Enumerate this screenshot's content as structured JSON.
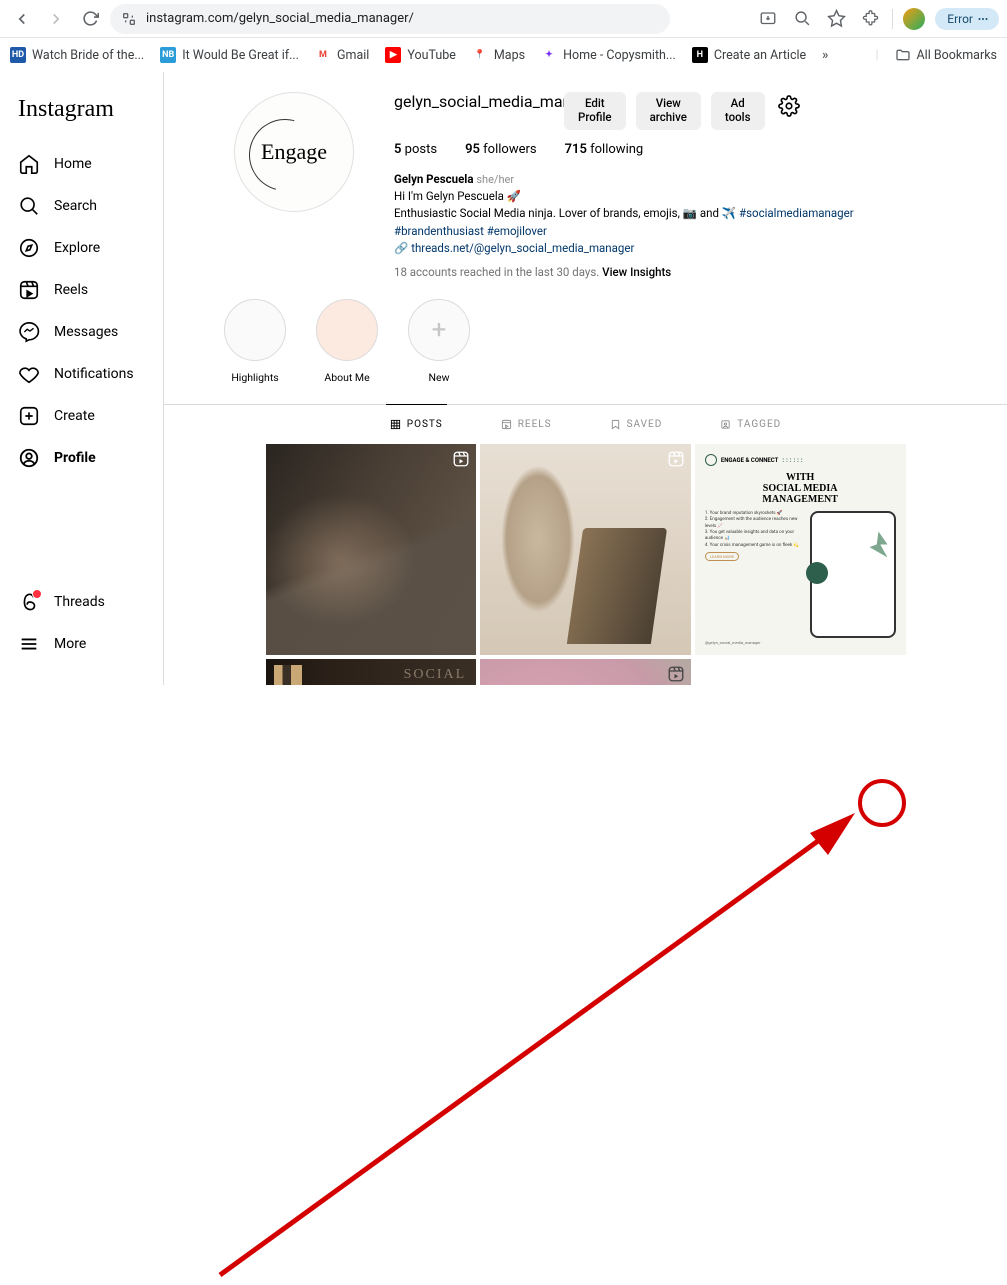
{
  "browser": {
    "url": "instagram.com/gelyn_social_media_manager/",
    "error_label": "Error"
  },
  "bookmarks": [
    {
      "icon": "HD",
      "icon_bg": "#1e5aa8",
      "icon_color": "#fff",
      "label": "Watch Bride of the..."
    },
    {
      "icon": "NB",
      "icon_bg": "#2b9cd8",
      "icon_color": "#fff",
      "label": "It Would Be Great if..."
    },
    {
      "icon": "M",
      "icon_bg": "#fff",
      "icon_color": "#ea4335",
      "label": "Gmail"
    },
    {
      "icon": "▶",
      "icon_bg": "#ff0000",
      "icon_color": "#fff",
      "label": "YouTube"
    },
    {
      "icon": "📍",
      "icon_bg": "transparent",
      "icon_color": "#34a853",
      "label": "Maps"
    },
    {
      "icon": "✦",
      "icon_bg": "#fff",
      "icon_color": "#7b2ff7",
      "label": "Home - Copysmith..."
    },
    {
      "icon": "H",
      "icon_bg": "#000",
      "icon_color": "#fff",
      "label": "Create an Article"
    }
  ],
  "all_bookmarks_label": "All Bookmarks",
  "sidebar": {
    "logo": "Instagram",
    "items": [
      {
        "label": "Home"
      },
      {
        "label": "Search"
      },
      {
        "label": "Explore"
      },
      {
        "label": "Reels"
      },
      {
        "label": "Messages"
      },
      {
        "label": "Notifications"
      },
      {
        "label": "Create"
      },
      {
        "label": "Profile"
      }
    ],
    "threads_label": "Threads",
    "more_label": "More"
  },
  "profile": {
    "username": "gelyn_social_media_manager",
    "buttons": {
      "edit": "Edit\nProfile",
      "archive": "View\narchive",
      "adtools": "Ad\ntools"
    },
    "stats": {
      "posts_n": "5",
      "posts_l": "posts",
      "followers_n": "95",
      "followers_l": "followers",
      "following_n": "715",
      "following_l": "following"
    },
    "display_name": "Gelyn Pescuela",
    "pronouns": "she/her",
    "bio_line1": "Hi I'm Gelyn Pescuela 🚀",
    "bio_line2a": "Enthusiastic Social Media ninja. Lover of brands, emojis, 📷 and ✈️ ",
    "bio_line2b": "#socialmediamanager",
    "bio_line3a": "#brandenthusiast",
    "bio_line3b": " #emojilover",
    "threads_link": "threads.net/@gelyn_social_media_manager",
    "insights_text": "18 accounts reached in the last 30 days. ",
    "insights_link": "View Insights",
    "pic_text": "Engage"
  },
  "highlights": [
    {
      "label": "Highlights"
    },
    {
      "label": "About Me"
    },
    {
      "label": "New"
    }
  ],
  "tabs": [
    {
      "label": "POSTS"
    },
    {
      "label": "REELS"
    },
    {
      "label": "SAVED"
    },
    {
      "label": "TAGGED"
    }
  ],
  "post3": {
    "brand": "ENGAGE & CONNECT",
    "title": "WITH\nSOCIAL MEDIA\nMANAGEMENT",
    "bullets": "1. Your brand reputation skyrockets 🚀\n2. Engagement with the audience reaches new levels 📈\n3. You get valuable insights and data on your audience 📊\n4. Your crisis management game is on fleek 💫",
    "cta": "LEARN MORE",
    "handle": "@gelyn_social_media_manager"
  }
}
